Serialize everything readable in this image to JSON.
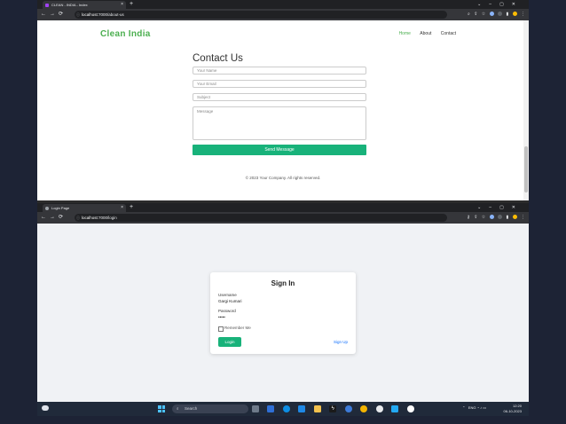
{
  "window1": {
    "tab_title": "CLEAN - INDIA - Index",
    "url_domain": "localhost",
    "url_path": ":7000/about-us",
    "page": {
      "brand": "Clean India",
      "nav": [
        "Home",
        "About",
        "Contact"
      ],
      "active_nav": "Home",
      "title": "Contact Us",
      "name_placeholder": "Your Name",
      "email_placeholder": "Your Email",
      "subject_placeholder": "Subject",
      "message_placeholder": "Message",
      "send_label": "Send Message",
      "footer": "© 2023 Your Company. All rights reserved."
    }
  },
  "window2": {
    "tab_title": "Login Page",
    "url_domain": "localhost",
    "url_path": ":7000/login",
    "page": {
      "title": "Sign In",
      "username_label": "Username",
      "username_value": "Gargi Kumari",
      "password_label": "Password",
      "password_value": "•••••",
      "remember_label": "Remember Me",
      "login_label": "Login",
      "signup_label": "Sign Up"
    }
  },
  "taskbar": {
    "search_placeholder": "Search",
    "lang": "ENG",
    "region": "IN",
    "time": "12:20",
    "date": "06-10-2023"
  },
  "colors": {
    "brand_green": "#4caf50",
    "button_green": "#18b27a",
    "link_blue": "#0d6efd",
    "browser_dark": "#202124"
  }
}
